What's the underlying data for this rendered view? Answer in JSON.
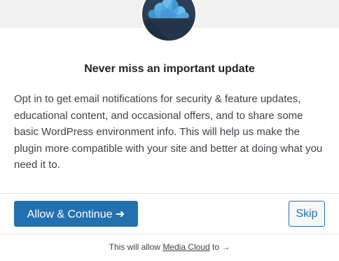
{
  "logo": {
    "icon": "cloud-icon",
    "background_color": "#2c3e57",
    "cloud_color": "#4fa8e0"
  },
  "headline": "Never miss an important update",
  "body": "Opt in to get email notifications for security & feature updates, educational content, and occasional offers, and to share some basic WordPress environment info. This will help us make the plugin more compatible with your site and better at doing what you need it to.",
  "actions": {
    "allow_label": "Allow & Continue ➜",
    "skip_label": "Skip",
    "primary_color": "#2271b1"
  },
  "footer": {
    "prefix": "This will allow",
    "link_text": "Media Cloud",
    "suffix": "to →"
  }
}
